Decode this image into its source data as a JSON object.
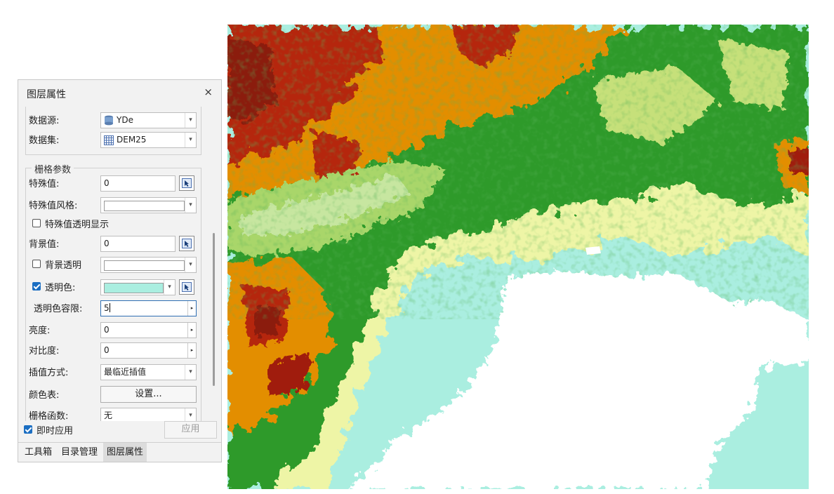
{
  "panel": {
    "title": "图层属性",
    "close_glyph": "×",
    "source_group": {
      "datasource_label": "数据源:",
      "datasource_value": "YDe",
      "dataset_label": "数据集:",
      "dataset_value": "DEM25"
    },
    "raster_group": {
      "legend": "栅格参数",
      "special_value_label": "特殊值:",
      "special_value": "0",
      "special_style_label": "特殊值风格:",
      "special_transparent_label": "特殊值透明显示",
      "special_transparent_checked": false,
      "background_label": "背景值:",
      "background_value": "0",
      "background_transparent_label": "背景透明",
      "background_transparent_checked": false,
      "transparent_color_label": "透明色:",
      "transparent_color_checked": true,
      "transparent_color": "#aaeee0",
      "tolerance_label": "透明色容限:",
      "tolerance_value": "5",
      "brightness_label": "亮度:",
      "brightness_value": "0",
      "contrast_label": "对比度:",
      "contrast_value": "0",
      "interp_label": "插值方式:",
      "interp_value": "最临近插值",
      "color_table_label": "颜色表:",
      "color_table_button": "设置...",
      "raster_function_label": "栅格函数:",
      "raster_function_value": "无"
    },
    "apply_now_label": "即时应用",
    "apply_now_checked": true,
    "apply_button": "应用",
    "tabs": [
      "工具箱",
      "目录管理",
      "图层属性"
    ],
    "active_tab": "图层属性"
  },
  "map": {
    "layer": "DEM25",
    "colors": {
      "high": "#8b1a0e",
      "upper": "#e58a00",
      "mid": "#2e8f2a",
      "low": "#f0f5a8",
      "lowest": "#aaeee0",
      "nodata": "#ffffff"
    }
  }
}
